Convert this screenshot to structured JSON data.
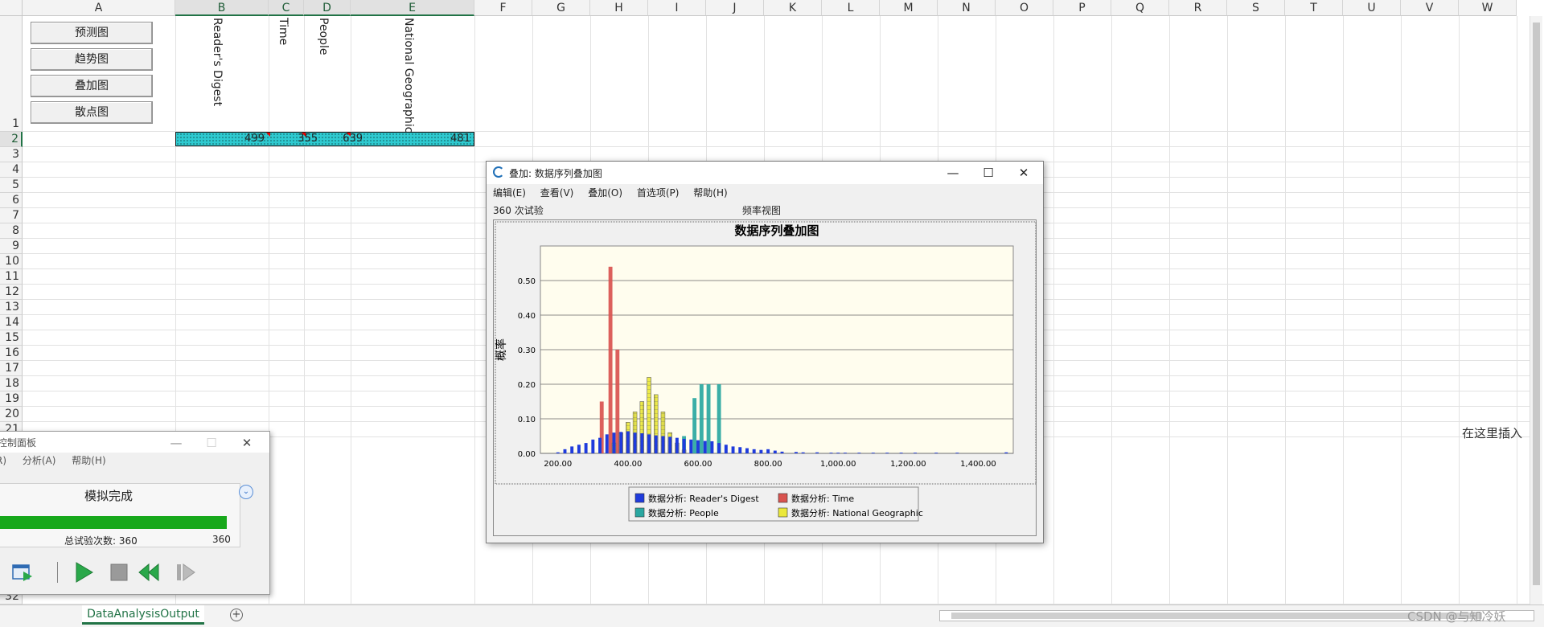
{
  "sheet": {
    "columns": [
      "A",
      "B",
      "C",
      "D",
      "E",
      "F",
      "G",
      "H",
      "I",
      "J",
      "K",
      "L",
      "M",
      "N",
      "O",
      "P",
      "Q",
      "R",
      "S",
      "T",
      "U",
      "V",
      "W"
    ],
    "rows": [
      "1",
      "2",
      "3",
      "4",
      "5",
      "6",
      "7",
      "8",
      "9",
      "10",
      "11",
      "12",
      "13",
      "14",
      "15",
      "16",
      "17",
      "18",
      "19",
      "20",
      "21",
      "32"
    ],
    "buttons": [
      "预测图",
      "趋势图",
      "叠加图",
      "散点图"
    ],
    "headers": [
      "Reader's Digest",
      "Time",
      "People",
      "National Geographic"
    ],
    "row2_values": [
      "499",
      "355",
      "639",
      "481"
    ],
    "insert_note": "在这里插入",
    "tab": "DataAnalysisOutput",
    "watermark": "CSDN @与知冷妖"
  },
  "chart_window": {
    "title": "叠加: 数据序列叠加图",
    "menu": [
      "编辑(E)",
      "查看(V)",
      "叠加(O)",
      "首选项(P)",
      "帮助(H)"
    ],
    "trials_label": "360 次试验",
    "view_label": "频率视图",
    "controls": {
      "minimize": "—",
      "maximize": "☐",
      "close": "✕"
    }
  },
  "chart_data": {
    "type": "bar",
    "title": "数据序列叠加图",
    "ylabel": "概率",
    "xlabel": "",
    "xlim": [
      150,
      1500
    ],
    "ylim": [
      0,
      0.6
    ],
    "x_ticks": [
      "200.00",
      "400.00",
      "600.00",
      "800.00",
      "1,000.00",
      "1,200.00",
      "1,400.00"
    ],
    "x_tick_values": [
      200,
      400,
      600,
      800,
      1000,
      1200,
      1400
    ],
    "y_ticks": [
      "0.00",
      "0.10",
      "0.20",
      "0.30",
      "0.40",
      "0.50"
    ],
    "y_tick_values": [
      0,
      0.1,
      0.2,
      0.3,
      0.4,
      0.5
    ],
    "grid": true,
    "legend_position": "bottom",
    "bin_width": 18,
    "series": [
      {
        "name": "数据分析: Time",
        "color": "#d9534f",
        "style": "solid",
        "x": [
          325,
          350,
          370
        ],
        "values": [
          0.15,
          0.54,
          0.3
        ]
      },
      {
        "name": "数据分析: People",
        "color": "#2aa7a1",
        "style": "solid",
        "x": [
          560,
          590,
          610,
          630,
          660
        ],
        "values": [
          0.05,
          0.16,
          0.2,
          0.2,
          0.2
        ]
      },
      {
        "name": "数据分析: National Geographic",
        "color": "#ebe83a",
        "style": "grid",
        "x": [
          360,
          380,
          400,
          420,
          440,
          460,
          480,
          500,
          520,
          540,
          560
        ],
        "values": [
          0.03,
          0.06,
          0.09,
          0.12,
          0.15,
          0.22,
          0.17,
          0.12,
          0.06,
          0.03,
          0.01
        ]
      },
      {
        "name": "数据分析: Reader's Digest",
        "color": "#1f3bdc",
        "style": "solid",
        "thin": true,
        "x": [
          200,
          220,
          240,
          260,
          280,
          300,
          320,
          340,
          360,
          380,
          400,
          420,
          440,
          460,
          480,
          500,
          520,
          540,
          560,
          580,
          600,
          620,
          640,
          660,
          680,
          700,
          720,
          740,
          760,
          780,
          800,
          820,
          840,
          880,
          900,
          940,
          980,
          1000,
          1020,
          1060,
          1100,
          1140,
          1180,
          1220,
          1280,
          1340,
          1480
        ],
        "values": [
          0.003,
          0.012,
          0.02,
          0.025,
          0.03,
          0.04,
          0.045,
          0.055,
          0.06,
          0.062,
          0.064,
          0.06,
          0.058,
          0.055,
          0.052,
          0.05,
          0.048,
          0.045,
          0.042,
          0.04,
          0.038,
          0.036,
          0.035,
          0.03,
          0.025,
          0.02,
          0.018,
          0.015,
          0.012,
          0.01,
          0.012,
          0.008,
          0.005,
          0.004,
          0.003,
          0.003,
          0.002,
          0.002,
          0.002,
          0.002,
          0.002,
          0.002,
          0.002,
          0.002,
          0.002,
          0.002,
          0.003
        ]
      }
    ],
    "legend": [
      "数据分析: Reader's Digest",
      "数据分析: Time",
      "数据分析: People",
      "数据分析: National Geographic"
    ],
    "legend_colors": [
      "#1f3bdc",
      "#d9534f",
      "#2aa7a1",
      "#ebe83a"
    ]
  },
  "control_panel": {
    "title": "控制面板",
    "menu": [
      "R)",
      "分析(A)",
      "帮助(H)"
    ],
    "status": "模拟完成",
    "progress": 1.0,
    "trials_label": "总试验次数: 360",
    "total": "360"
  }
}
